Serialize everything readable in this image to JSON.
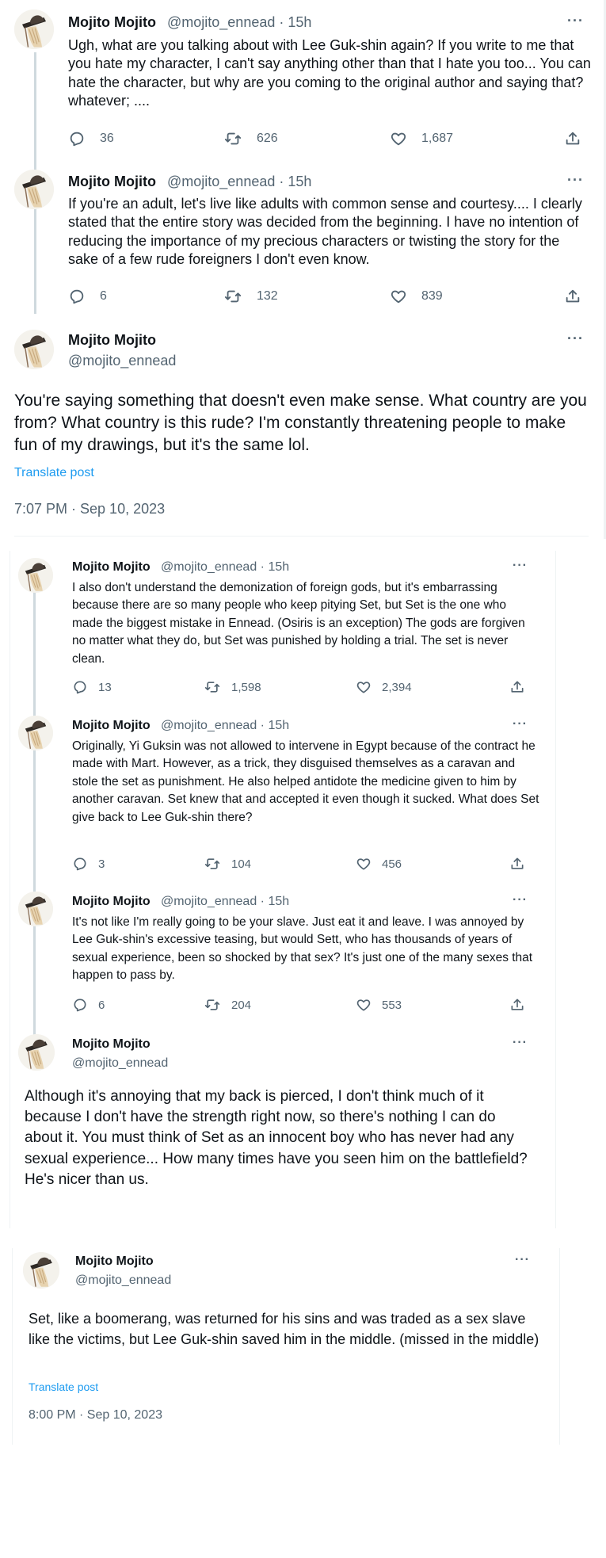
{
  "user": {
    "name": "Mojito Mojito",
    "handle": "@mojito_ennead",
    "time": "15h",
    "sep": "·",
    "more": "···"
  },
  "block1": {
    "tweets": [
      {
        "text": "Ugh, what are you talking about with Lee Guk-shin again? If you write to me that you hate my character, I can't say anything other than that I hate you too... You can hate the character, but why are you coming to the original author and saying that? whatever; ....",
        "replies": "36",
        "retweets": "626",
        "likes": "1,687"
      },
      {
        "text": "If you're an adult, let's live like adults with common sense and courtesy.... I clearly stated that the entire story was decided from the beginning. I have no intention of reducing the importance of my precious characters or twisting the story for the sake of a few rude foreigners I don't even know.",
        "replies": "6",
        "retweets": "132",
        "likes": "839"
      }
    ],
    "main": {
      "text": "You're saying something that doesn't even make sense. What country are you from? What country is this rude? I'm constantly threatening people to make fun of my drawings, but it's the same lol.",
      "translate": "Translate post",
      "timestamp": "7:07 PM · Sep 10, 2023"
    }
  },
  "block2": {
    "tweets": [
      {
        "text": "I also don't understand the demonization of foreign gods, but it's embarrassing because there are so many people who keep pitying Set, but Set is the one who made the biggest mistake in Ennead. (Osiris is an exception) The gods are forgiven no matter what they do, but Set was punished by holding a trial. The set is never clean.",
        "replies": "13",
        "retweets": "1,598",
        "likes": "2,394"
      },
      {
        "text": "Originally, Yi Guksin was not allowed to intervene in Egypt because of the contract he made with Mart. However, as a trick, they disguised themselves as a caravan and stole the set as punishment. He also helped antidote the medicine given to him by another caravan. Set knew that and accepted it even though it sucked. What does Set give back to Lee Guk-shin there?",
        "replies": "3",
        "retweets": "104",
        "likes": "456"
      },
      {
        "text": "It's not like I'm really going to be your slave. Just eat it and leave. I was annoyed by Lee Guk-shin's excessive teasing, but would Sett, who has thousands of years of sexual experience, been so shocked by that sex? It's just one of the many sexes that happen to pass by.",
        "replies": "6",
        "retweets": "204",
        "likes": "553"
      }
    ],
    "main": {
      "text": "Although it's annoying that my back is pierced, I don't think much of it because I don't have the strength right now, so there's nothing I can do about it. You must think of Set as an innocent boy who has never had any sexual experience... How many times have you seen him on the battlefield? He's nicer than us."
    }
  },
  "block3": {
    "main": {
      "text": "Set, like a boomerang, was returned for his sins and was traded as a sex slave like the victims, but Lee Guk-shin saved him in the middle. (missed in the middle)",
      "translate": "Translate post",
      "timestamp": "8:00 PM · Sep 10, 2023"
    }
  },
  "icons": {
    "reply": "reply-icon",
    "retweet": "retweet-icon",
    "like": "heart-icon",
    "share": "share-icon",
    "more": "more-icon"
  }
}
